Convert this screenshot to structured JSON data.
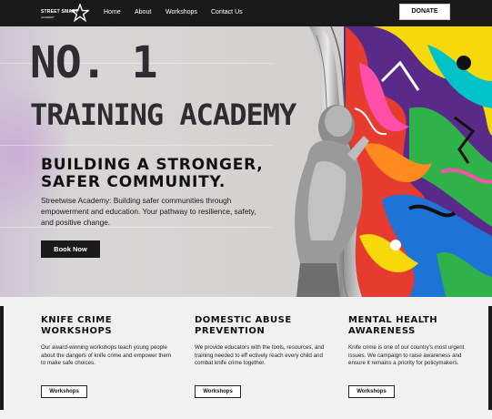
{
  "nav": {
    "logo_line1": "STREET SMART",
    "logo_line2": "ACADEMY",
    "links": [
      "Home",
      "About",
      "Workshops",
      "Contact Us"
    ],
    "donate": "DONATE"
  },
  "hero": {
    "line1": "NO. 1",
    "line2": "TRAINING ACADEMY",
    "tagline_1": "BUILDING A STRONGER,",
    "tagline_2": "SAFER COMMUNITY.",
    "description": "Streetwise Academy: Building safer communities through empowerment and education. Your pathway to resilience, safety, and positive change.",
    "cta": "Book Now"
  },
  "cards": [
    {
      "title_1": "KNIFE CRIME",
      "title_2": "WORKSHOPS",
      "body": "Our award-winning workshops teach young people about the dangers of knife crime and empower them to make safe choices.",
      "button": "Workshops"
    },
    {
      "title_1": "DOMESTIC ABUSE",
      "title_2": "PREVENTION",
      "body": "We provide educators with the tools, resources, and training needed to eff ectively reach every child and combat knife crime together.",
      "button": "Workshops"
    },
    {
      "title_1": "MENTAL HEALTH",
      "title_2": "AWARENESS",
      "body": "Knife crime is one of our country's most urgent issues. We campaign to raise awareness and ensure it remains a priority for policymakers.",
      "button": "Workshops"
    }
  ],
  "colors": {
    "nav_bg": "#1a1a1a",
    "card_bg": "#f1f1f1",
    "text_dark": "#111111"
  }
}
